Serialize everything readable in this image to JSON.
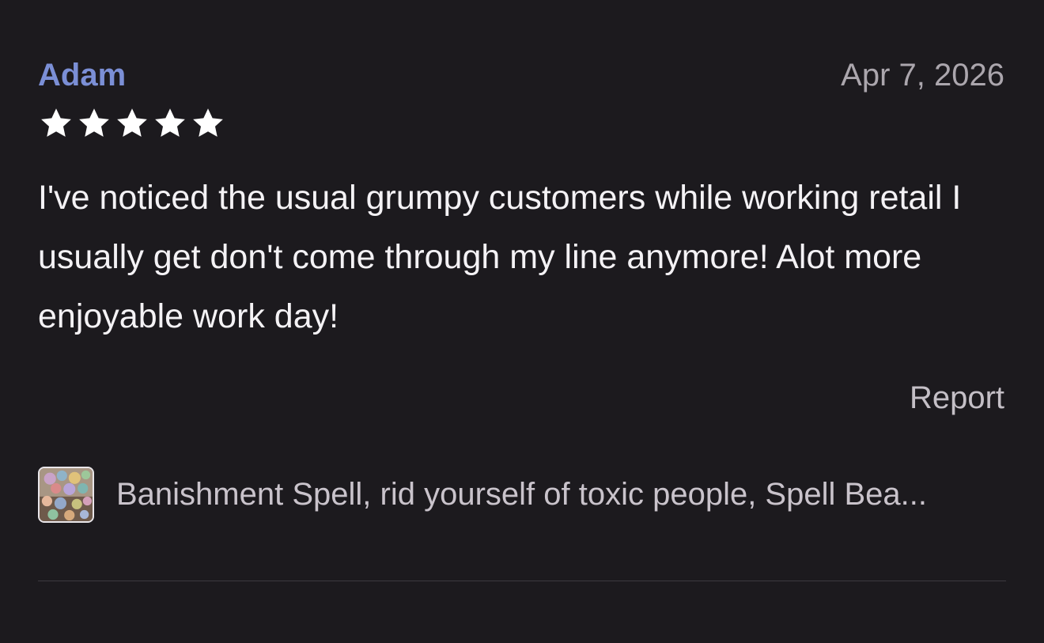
{
  "review": {
    "reviewer_name": "Adam",
    "date": "Apr 7, 2026",
    "rating": 5,
    "rating_max": 5,
    "body": "I've noticed the usual grumpy customers while working retail I usually get don't come through my line anymore! Alot more enjoyable work day!",
    "report_label": "Report"
  },
  "product": {
    "title": "Banishment Spell, rid yourself of toxic people, Spell Bea...",
    "thumbnail_icon": "product-thumbnail"
  },
  "colors": {
    "background": "#1c1a1e",
    "reviewer_name": "#7b8fd6",
    "star": "#ffffff",
    "text": "#f4f2f5",
    "muted": "#aba6ad"
  }
}
